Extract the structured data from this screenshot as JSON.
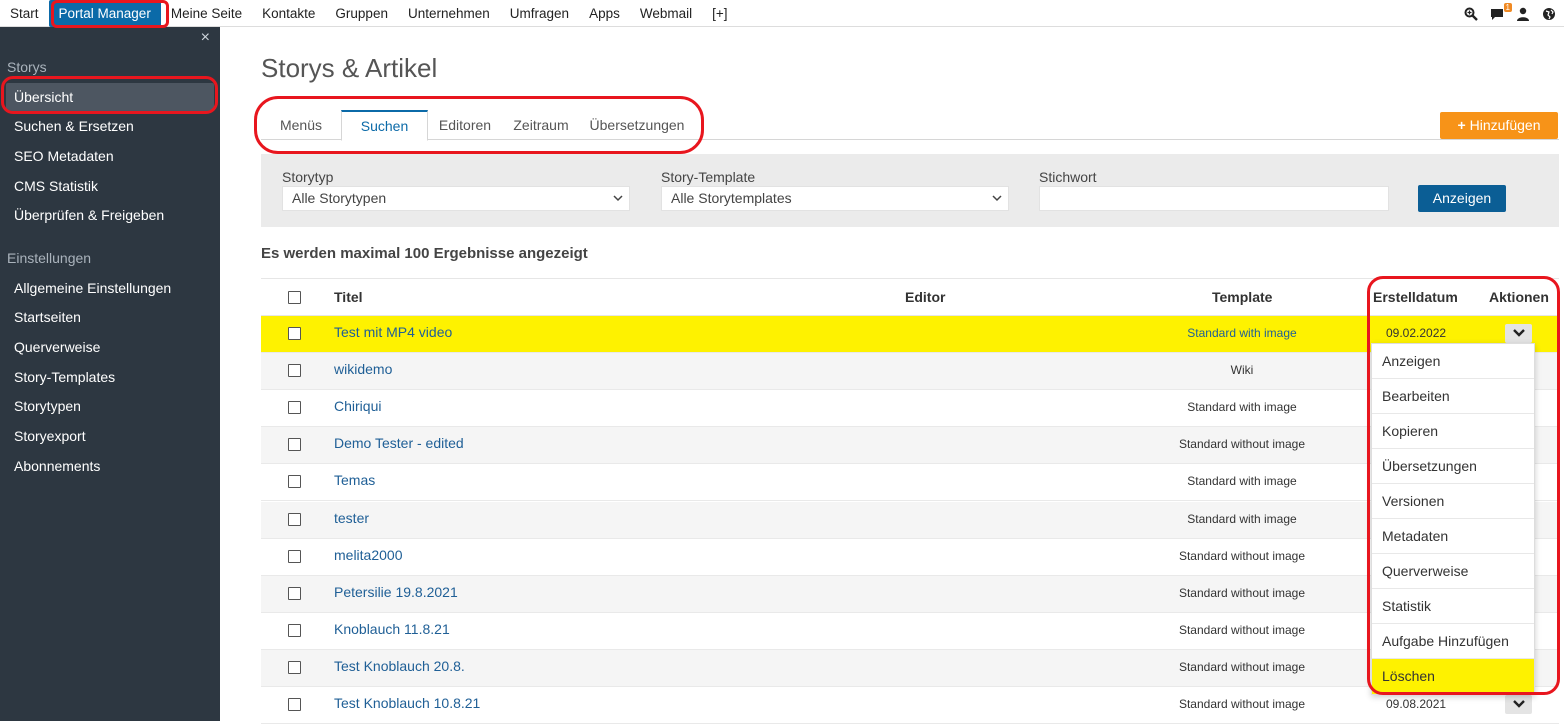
{
  "topnav": {
    "items": [
      "Start",
      "Portal Manager",
      "Meine Seite",
      "Kontakte",
      "Gruppen",
      "Unternehmen",
      "Umfragen",
      "Apps",
      "Webmail",
      "[+]"
    ],
    "badge_count": "1"
  },
  "sidebar": {
    "close_glyph": "×",
    "section_storys": "Storys",
    "storys_items": [
      "Übersicht",
      "Suchen & Ersetzen",
      "SEO Metadaten",
      "CMS Statistik",
      "Überprüfen & Freigeben"
    ],
    "section_settings": "Einstellungen",
    "settings_items": [
      "Allgemeine Einstellungen",
      "Startseiten",
      "Querverweise",
      "Story-Templates",
      "Storytypen",
      "Storyexport",
      "Abonnements"
    ]
  },
  "main": {
    "title": "Storys & Artikel",
    "tabs": [
      "Menüs",
      "Suchen",
      "Editoren",
      "Zeitraum",
      "Übersetzungen"
    ],
    "add_button": "Hinzufügen",
    "filter": {
      "storytyp_label": "Storytyp",
      "storytyp_value": "Alle Storytypen",
      "template_label": "Story-Template",
      "template_value": "Alle Storytemplates",
      "keyword_label": "Stichwort",
      "keyword_value": "",
      "show_button": "Anzeigen"
    },
    "results_note": "Es werden maximal 100 Ergebnisse angezeigt"
  },
  "table": {
    "headers": {
      "title": "Titel",
      "editor": "Editor",
      "template": "Template",
      "created": "Erstelldatum",
      "actions": "Aktionen"
    },
    "rows": [
      {
        "title": "Test mit MP4 video",
        "template": "Standard with image",
        "date": "09.02.2022"
      },
      {
        "title": "wikidemo",
        "template": "Wiki",
        "date": ""
      },
      {
        "title": "Chiriqui",
        "template": "Standard with image",
        "date": ""
      },
      {
        "title": "Demo Tester - edited",
        "template": "Standard without image",
        "date": ""
      },
      {
        "title": "Temas",
        "template": "Standard with image",
        "date": ""
      },
      {
        "title": "tester",
        "template": "Standard with image",
        "date": ""
      },
      {
        "title": "melita2000",
        "template": "Standard without image",
        "date": ""
      },
      {
        "title": "Petersilie 19.8.2021",
        "template": "Standard without image",
        "date": ""
      },
      {
        "title": "Knoblauch 11.8.21",
        "template": "Standard without image",
        "date": ""
      },
      {
        "title": "Test Knoblauch 20.8.",
        "template": "Standard without image",
        "date": ""
      },
      {
        "title": "Test Knoblauch 10.8.21",
        "template": "Standard without image",
        "date": "09.08.2021"
      }
    ]
  },
  "actions_menu": {
    "items": [
      "Anzeigen",
      "Bearbeiten",
      "Kopieren",
      "Übersetzungen",
      "Versionen",
      "Metadaten",
      "Querverweise",
      "Statistik",
      "Aufgabe Hinzufügen",
      "Löschen"
    ]
  }
}
